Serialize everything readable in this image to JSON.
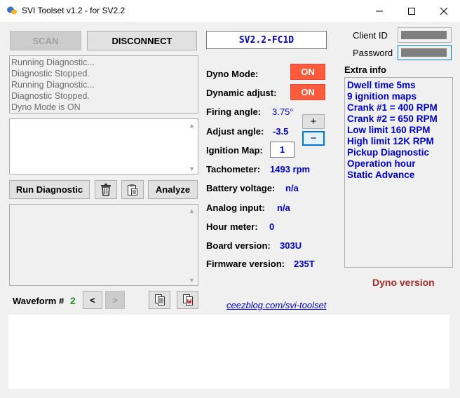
{
  "window": {
    "title": "SVI Toolset v1.2 - for SV2.2",
    "minimize_glyph": "─",
    "maximize_glyph": "☐",
    "close_glyph": "✕"
  },
  "toolbar": {
    "scan_label": "SCAN",
    "disconnect_label": "DISCONNECT",
    "device_id": "SV2.2-FC1D"
  },
  "auth": {
    "client_id_label": "Client ID",
    "password_label": "Password",
    "client_id_value": "",
    "password_value": ""
  },
  "status_log": [
    "Running Diagnostic...",
    "Diagnostic Stopped.",
    "Running Diagnostic...",
    "Diagnostic Stopped.",
    "Dyno Mode is ON"
  ],
  "diagnostic": {
    "run_label": "Run Diagnostic",
    "analyze_label": "Analyze",
    "trash_icon": "trash-icon",
    "clipboard_icon": "clipboard-icon"
  },
  "waveform": {
    "label": "Waveform #",
    "number": "2",
    "prev_label": "<",
    "next_label": ">",
    "copy_icon": "copy-icon",
    "save_icon": "save-icon"
  },
  "settings": {
    "dyno_mode_label": "Dyno Mode:",
    "dyno_mode_value": "ON",
    "dynamic_adjust_label": "Dynamic adjust:",
    "dynamic_adjust_value": "ON",
    "firing_angle_label": "Firing angle:",
    "firing_angle_value": "3.75°",
    "adjust_angle_label": "Adjust angle:",
    "adjust_angle_value": "-3.5",
    "plus_label": "+",
    "minus_label": "−",
    "ignition_map_label": "Ignition Map:",
    "ignition_map_value": "1"
  },
  "readings": {
    "tachometer_label": "Tachometer:",
    "tachometer_value": "1493 rpm",
    "battery_label": "Battery voltage:",
    "battery_value": "n/a",
    "analog_label": "Analog input:",
    "analog_value": "n/a",
    "hour_label": "Hour meter:",
    "hour_value": "0",
    "board_label": "Board version:",
    "board_value": "303U",
    "firmware_label": "Firmware version:",
    "firmware_value": "235T"
  },
  "extra_info": {
    "title": "Extra info",
    "items": [
      "Dwell time 5ms",
      "9 ignition maps",
      "Crank #1 = 400 RPM",
      "Crank #2 = 650 RPM",
      "Low limit 160 RPM",
      "High limit 12K RPM",
      "Pickup Diagnostic",
      "Operation hour",
      "Static Advance"
    ]
  },
  "footer": {
    "dyno_version": "Dyno version",
    "link": "ceezblog.com/svi-toolset"
  },
  "colors": {
    "accent_blue": "#0000cc",
    "on_button": "#ff5a3c",
    "dyno_version": "#a52a2a",
    "waveform_number": "#228b22"
  }
}
